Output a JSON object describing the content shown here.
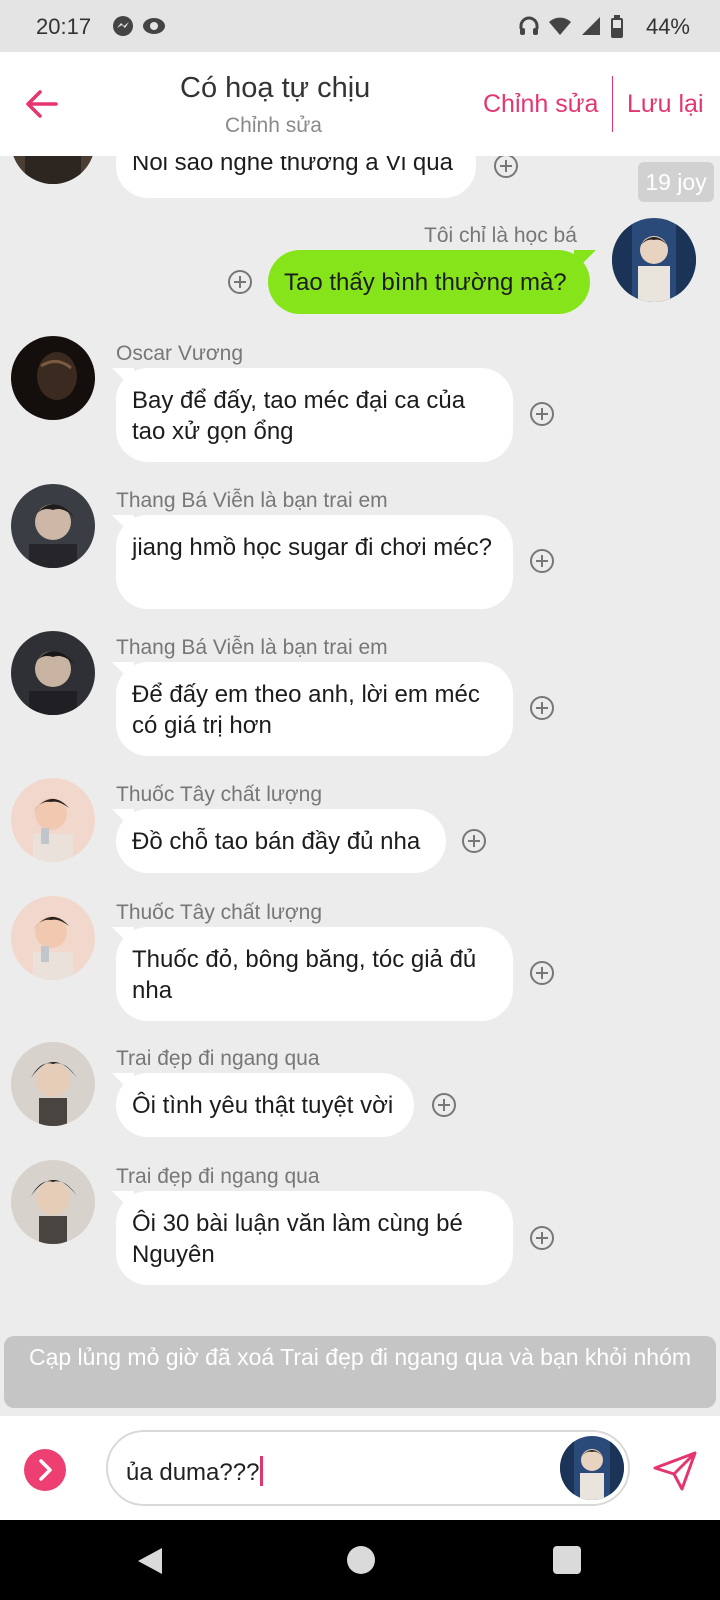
{
  "status_bar": {
    "time": "20:17",
    "battery": "44%"
  },
  "header": {
    "title": "Có hoạ tự chịu",
    "subtitle": "Chỉnh sửa",
    "edit_label": "Chỉnh sửa",
    "save_label": "Lưu lại",
    "accent_color": "#e5356f"
  },
  "joy_badge": "19 joy",
  "messages": [
    {
      "text": "Nói sao nghe thương ả Vi quá"
    },
    {
      "sender": "Tôi chỉ là học bá",
      "text": "Tao thấy bình thường mà?",
      "mine": true
    },
    {
      "sender": "Oscar Vương",
      "text": "Bay để đấy, tao méc đại ca của tao xử gọn ổng"
    },
    {
      "sender": "Thang Bá Viễn là bạn trai em",
      "text": "jiang hmồ học sugar đi chơi méc?"
    },
    {
      "sender": "Thang Bá Viễn là bạn trai em",
      "text": "Để đấy em theo anh, lời em méc có giá trị hơn"
    },
    {
      "sender": "Thuốc Tây chất lượng",
      "text": "Đồ chỗ tao bán đầy đủ nha"
    },
    {
      "sender": "Thuốc Tây chất lượng",
      "text": "Thuốc đỏ, bông băng, tóc giả đủ nha"
    },
    {
      "sender": "Trai đẹp đi ngang qua",
      "text": "Ôi tình yêu thật tuyệt vời"
    },
    {
      "sender": "Trai đẹp đi ngang qua",
      "text": "Ôi 30 bài luận văn làm cùng bé Nguyên"
    }
  ],
  "system_notice": "Cạp lủng mỏ giờ đã xoá Trai đẹp đi ngang qua và bạn khỏi nhóm",
  "input": {
    "value": "ủa duma???"
  },
  "colors": {
    "my_bubble": "#86e51a",
    "background": "#ececec",
    "fab": "#ee3f72"
  }
}
